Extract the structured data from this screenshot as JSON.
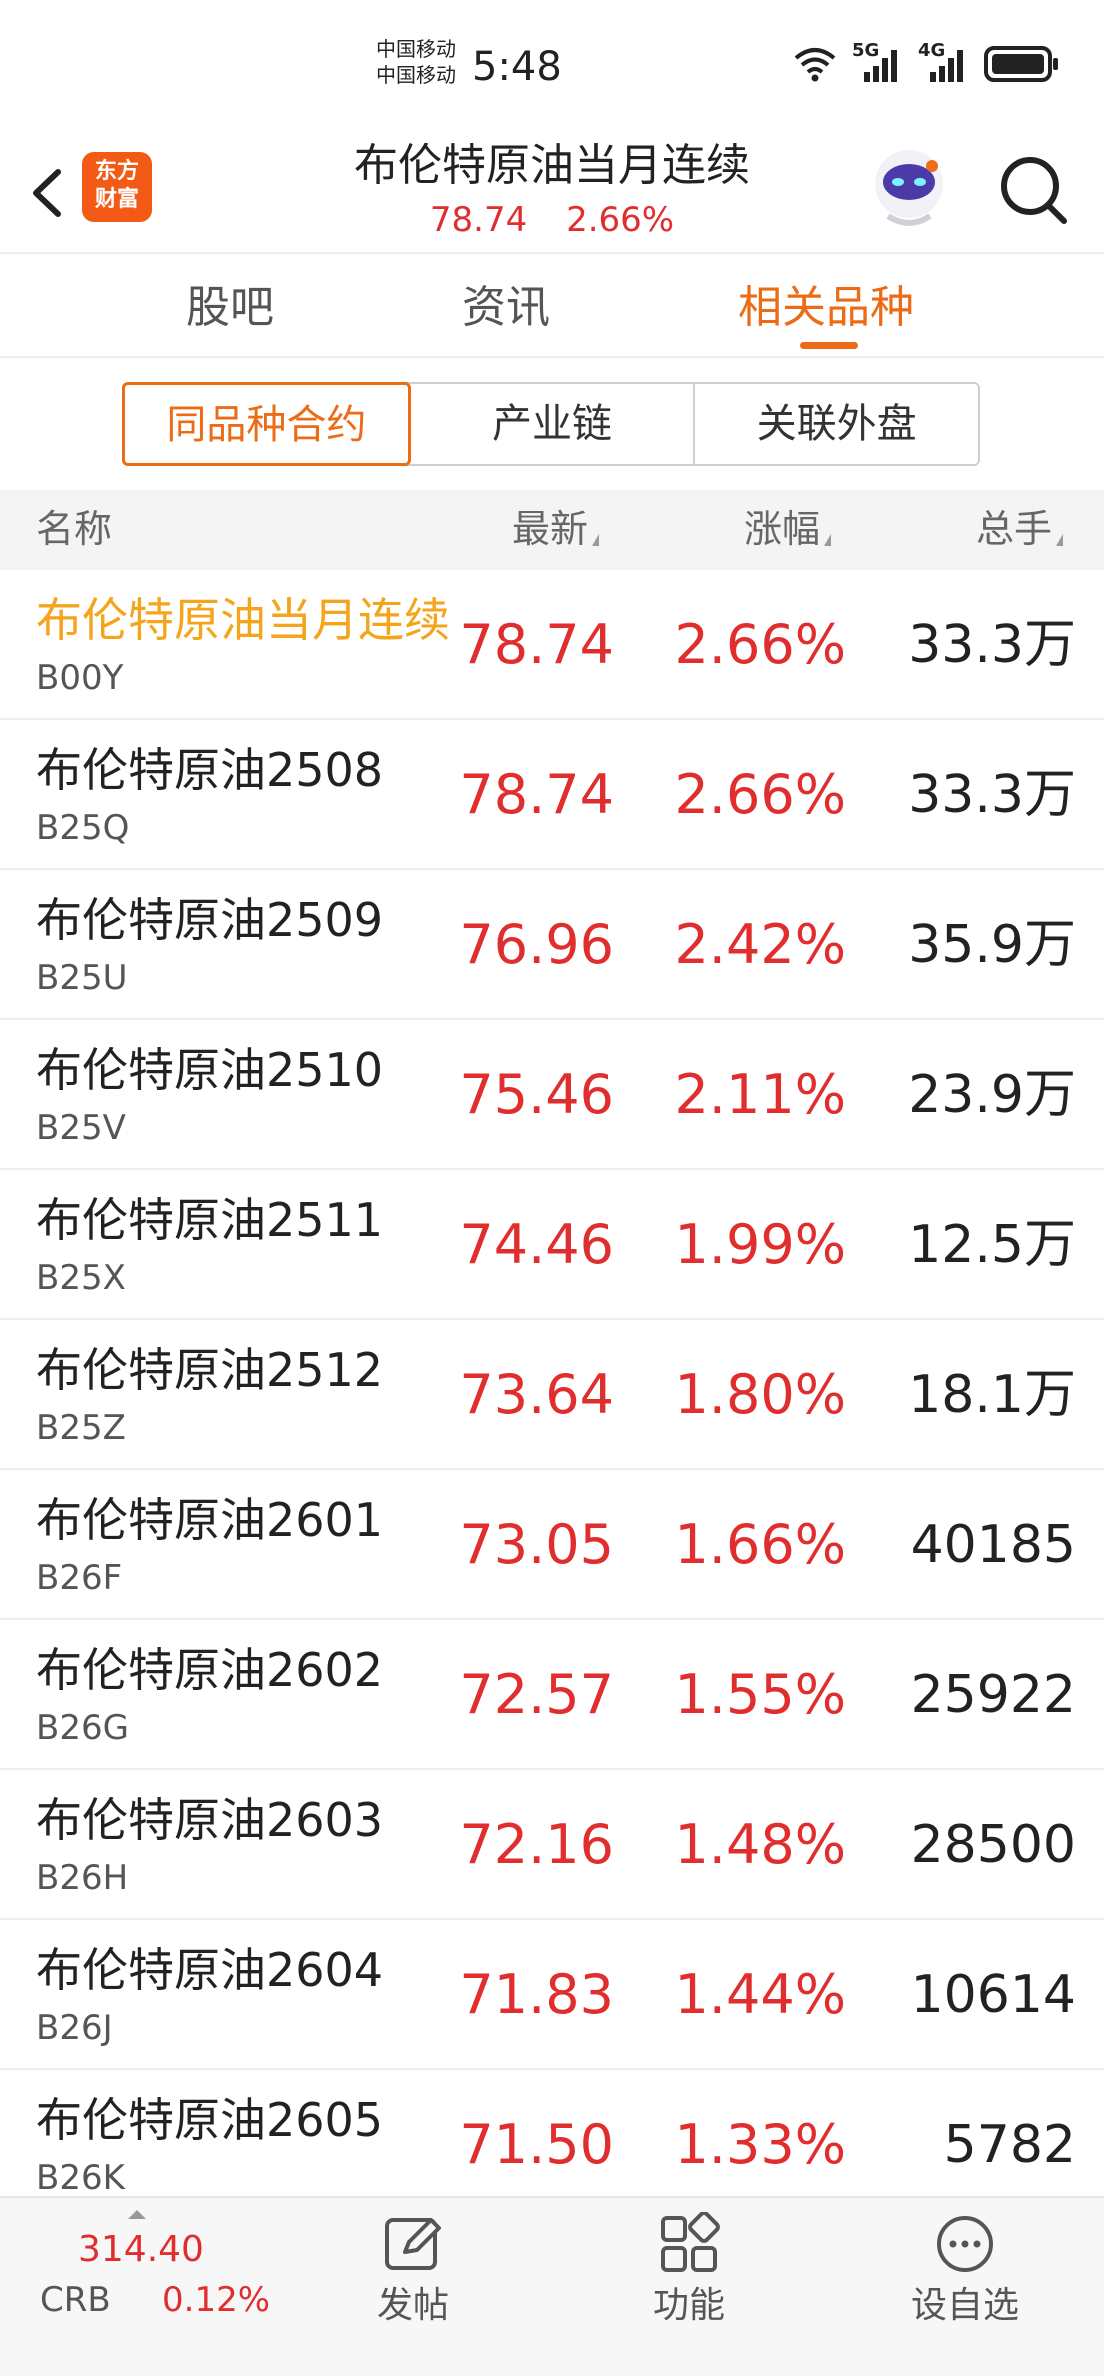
{
  "status_bar": {
    "carrier_1": "中国移动",
    "carrier_2": "中国移动",
    "time": "5:48",
    "signal_1": "5G",
    "signal_2": "4G"
  },
  "header": {
    "logo_line1": "东方",
    "logo_line2": "财富",
    "title": "布伦特原油当月连续",
    "price": "78.74",
    "change_pct": "2.66%"
  },
  "tabs": [
    {
      "label": "股吧",
      "active": false
    },
    {
      "label": "资讯",
      "active": false
    },
    {
      "label": "相关品种",
      "active": true
    }
  ],
  "segments": [
    {
      "label": "同品种合约",
      "active": true
    },
    {
      "label": "产业链",
      "active": false
    },
    {
      "label": "关联外盘",
      "active": false
    }
  ],
  "columns": {
    "name": "名称",
    "latest": "最新",
    "change": "涨幅",
    "volume": "总手"
  },
  "rows": [
    {
      "name": "布伦特原油当月连续",
      "code": "B00Y",
      "price": "78.74",
      "change": "2.66%",
      "volume": "33.3万",
      "highlight": true
    },
    {
      "name": "布伦特原油2508",
      "code": "B25Q",
      "price": "78.74",
      "change": "2.66%",
      "volume": "33.3万"
    },
    {
      "name": "布伦特原油2509",
      "code": "B25U",
      "price": "76.96",
      "change": "2.42%",
      "volume": "35.9万"
    },
    {
      "name": "布伦特原油2510",
      "code": "B25V",
      "price": "75.46",
      "change": "2.11%",
      "volume": "23.9万"
    },
    {
      "name": "布伦特原油2511",
      "code": "B25X",
      "price": "74.46",
      "change": "1.99%",
      "volume": "12.5万"
    },
    {
      "name": "布伦特原油2512",
      "code": "B25Z",
      "price": "73.64",
      "change": "1.80%",
      "volume": "18.1万"
    },
    {
      "name": "布伦特原油2601",
      "code": "B26F",
      "price": "73.05",
      "change": "1.66%",
      "volume": "40185"
    },
    {
      "name": "布伦特原油2602",
      "code": "B26G",
      "price": "72.57",
      "change": "1.55%",
      "volume": "25922"
    },
    {
      "name": "布伦特原油2603",
      "code": "B26H",
      "price": "72.16",
      "change": "1.48%",
      "volume": "28500"
    },
    {
      "name": "布伦特原油2604",
      "code": "B26J",
      "price": "71.83",
      "change": "1.44%",
      "volume": "10614"
    },
    {
      "name": "布伦特原油2605",
      "code": "B26K",
      "price": "71.50",
      "change": "1.33%",
      "volume": "5782"
    }
  ],
  "bottom_bar": {
    "index_value": "314.40",
    "index_name": "CRB",
    "index_change": "0.12%",
    "post_label": "发帖",
    "function_label": "功能",
    "watchlist_label": "设自选"
  },
  "colors": {
    "accent": "#ec6b16",
    "up_red": "#e02e2e",
    "highlight_yellow": "#f5a51b"
  }
}
